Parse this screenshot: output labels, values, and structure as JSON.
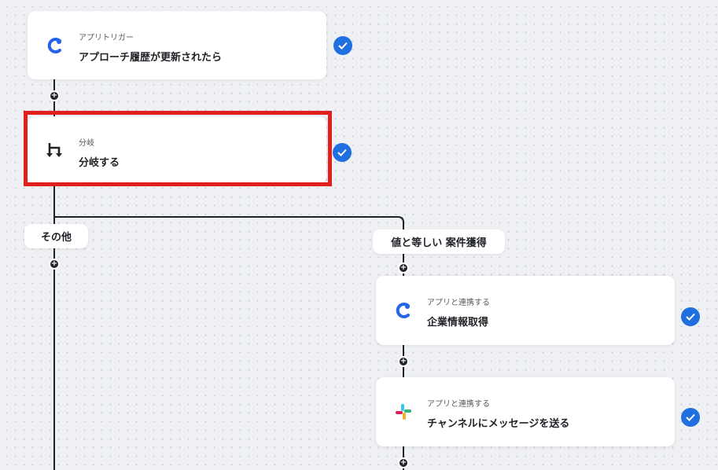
{
  "nodes": {
    "trigger": {
      "subtitle": "アプリトリガー",
      "title": "アプローチ履歴が更新されたら",
      "icon": "app-logo-icon"
    },
    "branch": {
      "subtitle": "分岐",
      "title": "分岐する",
      "icon": "branch-icon"
    },
    "company": {
      "subtitle": "アプリと連携する",
      "title": "企業情報取得",
      "icon": "app-logo-icon"
    },
    "slack": {
      "subtitle": "アプリと連携する",
      "title": "チャンネルにメッセージを送る",
      "icon": "slack-icon"
    }
  },
  "branches": {
    "other": "その他",
    "equal": "値と等しい 案件獲得"
  },
  "colors": {
    "accent": "#1f6fe0",
    "selection": "#e0201d",
    "line": "#1f2226"
  }
}
